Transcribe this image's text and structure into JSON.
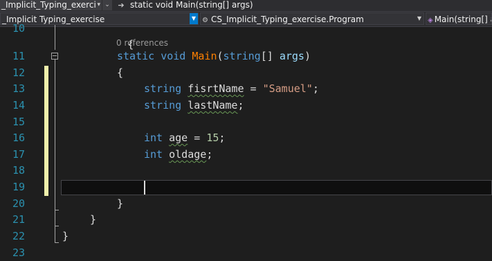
{
  "top_tabs": {
    "project_tab": "_Implicit_Typing_exerci",
    "member_breadcrumb": "static void Main(string[] args)"
  },
  "navigation_bar": {
    "project": "_Implicit Typing_exercise",
    "type": "CS_Implicit_Typing_exercise.Program",
    "member": "Main(string[] args)"
  },
  "editor": {
    "line_numbers": [
      "10",
      "11",
      "12",
      "13",
      "14",
      "15",
      "16",
      "17",
      "18",
      "19",
      "20",
      "21",
      "22",
      "23"
    ],
    "codelens": "0 references",
    "code": {
      "l10": "{",
      "l11_kw1": "static",
      "l11_kw2": "void",
      "l11_method": "Main",
      "l11_p1": "(",
      "l11_kw3": "string",
      "l11_p2": "[]",
      "l11_param": "args",
      "l11_p3": ")",
      "l12": "{",
      "l13_kw": "string",
      "l13_var": "fisrtName",
      "l13_op": " = ",
      "l13_str": "\"Samuel\"",
      "l13_end": ";",
      "l14_kw": "string",
      "l14_var": "lastName",
      "l14_end": ";",
      "l16_kw": "int",
      "l16_var": "age",
      "l16_op": " = ",
      "l16_num": "15",
      "l16_end": ";",
      "l17_kw": "int",
      "l17_var": "oldage",
      "l17_end": ";",
      "l20": "}",
      "l21": "}",
      "l22": "}"
    }
  },
  "colors": {
    "background": "#1e1e1e",
    "keyword": "#569cd6",
    "method": "#ff8000",
    "parameter": "#9cdcfe",
    "string": "#d69d85",
    "number": "#b5cea8",
    "line_number": "#2b91af",
    "change_bar": "#eff0ab"
  }
}
